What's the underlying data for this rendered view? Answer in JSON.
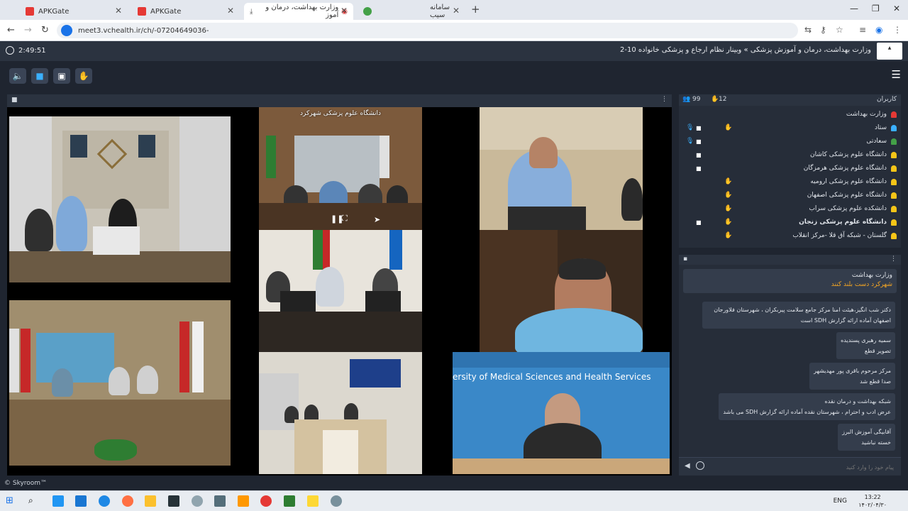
{
  "browser": {
    "tabs": [
      {
        "title": "APKGate",
        "active": false
      },
      {
        "title": "APKGate",
        "active": false
      },
      {
        "title": "وزارت بهداشت، درمان و آموز",
        "active": true
      },
      {
        "title": "سامانه سیب",
        "active": false
      }
    ],
    "url": "meet3.vchealth.ir/ch/-07204649036-"
  },
  "meeting": {
    "elapsed": "2:49:51",
    "title": "وزارت بهداشت، درمان و آموزش پزشکی » وبینار نظام ارجاع و پزشکی خانواده 10-2"
  },
  "video": {
    "tile_label": "دانشگاه علوم پزشکی شهرکرد",
    "banner_text": "ersity of Medical Sciences and Health Services"
  },
  "users": {
    "title": "کاربران",
    "online_count": "99",
    "hand_count": "12",
    "list": [
      {
        "name": "وزارت بهداشت",
        "color": "#e53935",
        "cam": false,
        "mic": false,
        "hand": false,
        "bold": false
      },
      {
        "name": "ستاد",
        "color": "#3ab0ff",
        "cam": true,
        "mic": true,
        "hand": true,
        "bold": false
      },
      {
        "name": "سعادتی",
        "color": "#43a047",
        "cam": true,
        "mic": true,
        "hand": false,
        "bold": false
      },
      {
        "name": "دانشگاه علوم پزشکی کاشان",
        "color": "#f5c518",
        "cam": true,
        "mic": false,
        "hand": false,
        "bold": false
      },
      {
        "name": "دانشگاه علوم پزشکی هرمزگان",
        "color": "#f5c518",
        "cam": true,
        "mic": false,
        "hand": false,
        "bold": false
      },
      {
        "name": "دانشگاه علوم پزشکی ارومیه",
        "color": "#f5c518",
        "cam": false,
        "mic": false,
        "hand": true,
        "bold": false
      },
      {
        "name": "دانشگاه علوم پزشکی اصفهان",
        "color": "#f5c518",
        "cam": false,
        "mic": false,
        "hand": true,
        "bold": false
      },
      {
        "name": "دانشکده علوم پزشکی سراب",
        "color": "#f5c518",
        "cam": false,
        "mic": false,
        "hand": true,
        "bold": false
      },
      {
        "name": "دانشگاه علوم پزشکی زنجان",
        "color": "#f5c518",
        "cam": true,
        "mic": false,
        "hand": true,
        "bold": true
      },
      {
        "name": "گلستان - شبکه آق قلا -مرکز انقلاب",
        "color": "#f5c518",
        "cam": false,
        "mic": false,
        "hand": true,
        "bold": false
      }
    ]
  },
  "chat": {
    "notice_sender": "وزارت بهداشت",
    "notice_text": "شهرکرد دست بلند کنند",
    "messages": [
      {
        "line1": "دکتر شب انگیز،هیئت امنا مرکز جامع سلامت پیربکران ، شهرستان فلاورجان",
        "line2": "اصفهان آماده ارائه گزارش SDH است"
      },
      {
        "line1": "سمیه رهبری پسندیده",
        "line2": "تصویر قطع"
      },
      {
        "line1": "مرکز مرحوم باقری پور مهدیشهر",
        "line2": "صدا قطع شد"
      },
      {
        "line1": "شبکه بهداشت و درمان نقده",
        "line2": "عرض ادب و احترام ، شهرستان نقده آماده ارائه گزارش SDH می باشد"
      },
      {
        "line1": "آقابیگی آموزش البرز",
        "line2": "خسته نباشید"
      }
    ],
    "input_placeholder": "پیام خود را وارد کنید"
  },
  "footer": {
    "brand": "© Skyroom™"
  },
  "taskbar": {
    "lang": "ENG",
    "time": "13:22",
    "date": "۱۴۰۲/۰۴/۳۰"
  }
}
